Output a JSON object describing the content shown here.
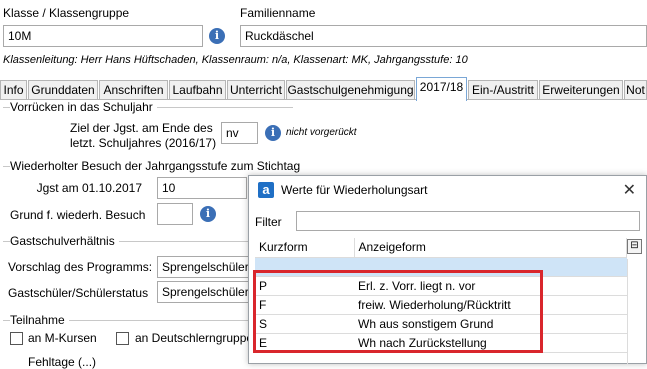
{
  "header": {
    "class_label": "Klasse / Klassengruppe",
    "class_value": "10M",
    "family_label": "Familienname",
    "family_value": "Ruckdäschel",
    "class_info": "Klassenleitung: Herr Hans Hüftschaden, Klassenraum: n/a, Klassenart: MK, Jahrgangsstufe: 10"
  },
  "tabs": [
    {
      "label": "Info"
    },
    {
      "label": "Grunddaten"
    },
    {
      "label": "Anschriften"
    },
    {
      "label": "Laufbahn"
    },
    {
      "label": "Unterricht"
    },
    {
      "label": "Gastschulgenehmigung"
    },
    {
      "label": "2017/18"
    },
    {
      "label": "Ein-/Austritt"
    },
    {
      "label": "Erweiterungen"
    },
    {
      "label": "Not"
    }
  ],
  "vorruecken": {
    "title": "Vorrücken in das Schuljahr",
    "ziel_label_1": "Ziel der Jgst. am Ende des",
    "ziel_label_2": "letzt. Schuljahres (2016/17)",
    "ziel_value": "nv",
    "ziel_note": "nicht vorgerückt"
  },
  "wiederholt": {
    "title": "Wiederholter Besuch der Jahrgangsstufe zum Stichtag",
    "jgst_label": "Jgst am 01.10.2017",
    "jgst_value": "10",
    "grund_label": "Grund f. wiederh. Besuch",
    "grund_value": ""
  },
  "gastschul": {
    "title": "Gastschulverhältnis",
    "vorschlag_label": "Vorschlag des Programms:",
    "vorschlag_value": "Sprengelschüler",
    "status_label": "Gastschüler/Schülerstatus",
    "status_value": "Sprengelschüler"
  },
  "teilnahme": {
    "title": "Teilnahme",
    "m_kurse": "an M-Kursen",
    "deutsch": "an Deutschlerngruppe",
    "cut_label": "Fehltage (...)"
  },
  "dialog": {
    "title": "Werte für Wiederholungsart",
    "filter_label": "Filter",
    "filter_value": "",
    "col_kurz": "Kurzform",
    "col_anzeige": "Anzeigeform",
    "rows": [
      {
        "kurz": "",
        "anzeige": ""
      },
      {
        "kurz": "P",
        "anzeige": "Erl. z. Vorr. liegt n. vor"
      },
      {
        "kurz": "F",
        "anzeige": "freiw. Wiederholung/Rücktritt"
      },
      {
        "kurz": "S",
        "anzeige": "Wh aus sonstigem Grund"
      },
      {
        "kurz": "E",
        "anzeige": "Wh nach Zurückstellung"
      }
    ]
  },
  "colors": {
    "accent": "#3b6fb6",
    "selected_row": "#cfe4f7",
    "highlight": "#d9262c"
  }
}
